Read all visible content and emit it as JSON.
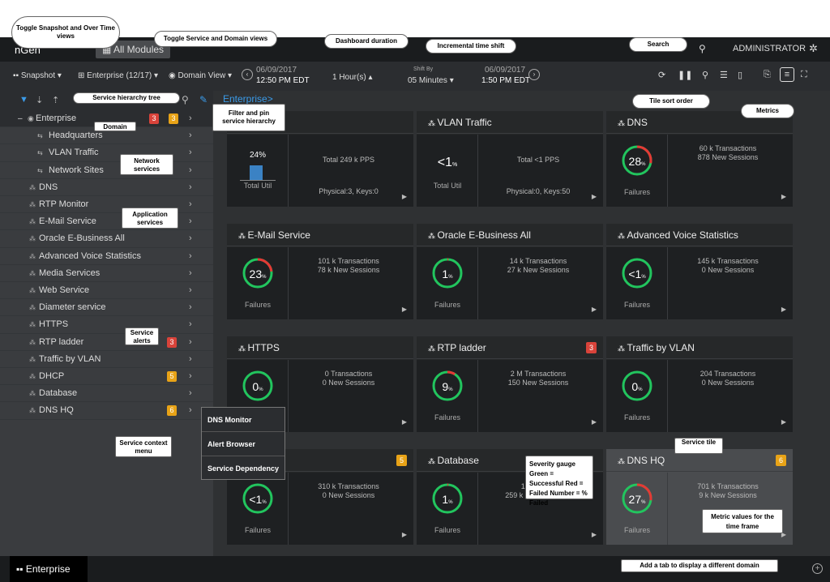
{
  "app": {
    "logo": "nGen",
    "modules": "All Modules",
    "user": "ADMINISTRATOR"
  },
  "toolbar": {
    "snapshot": "Snapshot",
    "enterprise": "Enterprise (12/17)",
    "domain_view": "Domain View",
    "start_date": "06/09/2017",
    "start_time": "12:50 PM EDT",
    "duration": "1 Hour(s)",
    "shift_label": "Shift By",
    "shift_value": "05 Minutes",
    "end_date": "06/09/2017",
    "end_time": "1:50 PM EDT"
  },
  "breadcrumb": "Enterprise>",
  "sidebar": {
    "root": {
      "label": "Enterprise",
      "badge1": "3",
      "badge2": "3"
    },
    "items": [
      {
        "label": "Headquarters",
        "icon": "network",
        "badge": ""
      },
      {
        "label": "VLAN Traffic",
        "icon": "network",
        "badge": ""
      },
      {
        "label": "Network Sites",
        "icon": "network",
        "badge": ""
      },
      {
        "label": "DNS",
        "icon": "app",
        "badge": ""
      },
      {
        "label": "RTP Monitor",
        "icon": "app",
        "badge": ""
      },
      {
        "label": "E-Mail Service",
        "icon": "app",
        "badge": ""
      },
      {
        "label": "Oracle E-Business All",
        "icon": "app",
        "badge": ""
      },
      {
        "label": "Advanced Voice Statistics",
        "icon": "app",
        "badge": ""
      },
      {
        "label": "Media Services",
        "icon": "app",
        "badge": ""
      },
      {
        "label": "Web Service",
        "icon": "app",
        "badge": ""
      },
      {
        "label": "Diameter service",
        "icon": "app",
        "badge": ""
      },
      {
        "label": "HTTPS",
        "icon": "app",
        "badge": ""
      },
      {
        "label": "RTP ladder",
        "icon": "app",
        "badge": "3",
        "badge_color": "#d9433a"
      },
      {
        "label": "Traffic by VLAN",
        "icon": "app",
        "badge": ""
      },
      {
        "label": "DHCP",
        "icon": "app",
        "badge": "5",
        "badge_color": "#e8a317"
      },
      {
        "label": "Database",
        "icon": "app",
        "badge": ""
      },
      {
        "label": "DNS HQ",
        "icon": "app",
        "badge": "6",
        "badge_color": "#e8a317"
      }
    ]
  },
  "context_menu": [
    "DNS Monitor",
    "Alert Browser",
    "Service Dependency"
  ],
  "tiles": [
    {
      "title": "rs",
      "type": "util",
      "util": "24%",
      "util_frac": 0.24,
      "m1": "Total    249 k PPS",
      "m2": "Physical:3, Keys:0",
      "foot": "Total Util"
    },
    {
      "title": "VLAN Traffic",
      "type": "util",
      "util": "<1",
      "pct": "%",
      "m1": "Total    <1 PPS",
      "m2": "Physical:0, Keys:50",
      "foot": "Total Util"
    },
    {
      "title": "DNS",
      "value": "28",
      "frac": 0.28,
      "m1": "60 k Transactions",
      "m2": "878 New Sessions",
      "foot": "Failures"
    },
    {
      "title": "E-Mail Service",
      "value": "23",
      "frac": 0.23,
      "m1": "101 k Transactions",
      "m2": "78 k New Sessions",
      "foot": "Failures"
    },
    {
      "title": "Oracle E-Business All",
      "value": "1",
      "frac": 0.01,
      "m1": "14 k Transactions",
      "m2": "27 k New Sessions",
      "foot": "Failures"
    },
    {
      "title": "Advanced Voice Statistics",
      "value": "<1",
      "frac": 0.0,
      "m1": "145 k Transactions",
      "m2": "0 New Sessions",
      "foot": "Failures"
    },
    {
      "title": "HTTPS",
      "value": "0",
      "frac": 0.0,
      "m1": "0 Transactions",
      "m2": "0 New Sessions",
      "foot": "Failures"
    },
    {
      "title": "RTP ladder",
      "value": "9",
      "frac": 0.09,
      "m1": "2 M Transactions",
      "m2": "150 New Sessions",
      "foot": "Failures",
      "badge": "3",
      "badge_color": "#d9433a"
    },
    {
      "title": "Traffic by VLAN",
      "value": "0",
      "frac": 0.0,
      "m1": "204 Transactions",
      "m2": "0 New Sessions",
      "foot": "Failures"
    },
    {
      "title": "",
      "value": "<1",
      "frac": 0.0,
      "m1": "310 k Transactions",
      "m2": "0 New Sessions",
      "foot": "Failures",
      "badge": "5",
      "badge_color": "#e8a317"
    },
    {
      "title": "Database",
      "value": "1",
      "frac": 0.01,
      "m1": "143 k Tran",
      "m2": "259 k New Sessions",
      "foot": "Failures"
    },
    {
      "title": "DNS HQ",
      "value": "27",
      "frac": 0.27,
      "m1": "701 k Transactions",
      "m2": "9 k New Sessions",
      "foot": "Failures",
      "badge": "6",
      "badge_color": "#e8a317"
    }
  ],
  "bottom_tab": "Enterprise",
  "callouts": {
    "toggle_snapshot": "Toggle Snapshot and Over Time views",
    "toggle_service": "Toggle Service and Domain views",
    "dashboard_duration": "Dashboard duration",
    "incremental": "Incremental time shift",
    "search": "Search",
    "tile_sort": "Tile sort order",
    "metrics": "Metrics",
    "hierarchy_tree": "Service hierarchy tree",
    "filter_pin": "Filter and pin service hierarchy",
    "domain": "Domain",
    "network_services": "Network services",
    "application_services": "Application services",
    "service_alerts": "Service alerts",
    "context_menu": "Service context menu",
    "severity": "Severity gauge Green = Successful Red = Failed Number = % Failed",
    "service_tile": "Service tile",
    "metric_values": "Metric values for the time frame",
    "add_tab": "Add a tab to display a different domain"
  },
  "colors": {
    "success": "#22c55e",
    "fail": "#e53935",
    "util_bar": "#3b82c4",
    "link": "#3b9be8"
  }
}
